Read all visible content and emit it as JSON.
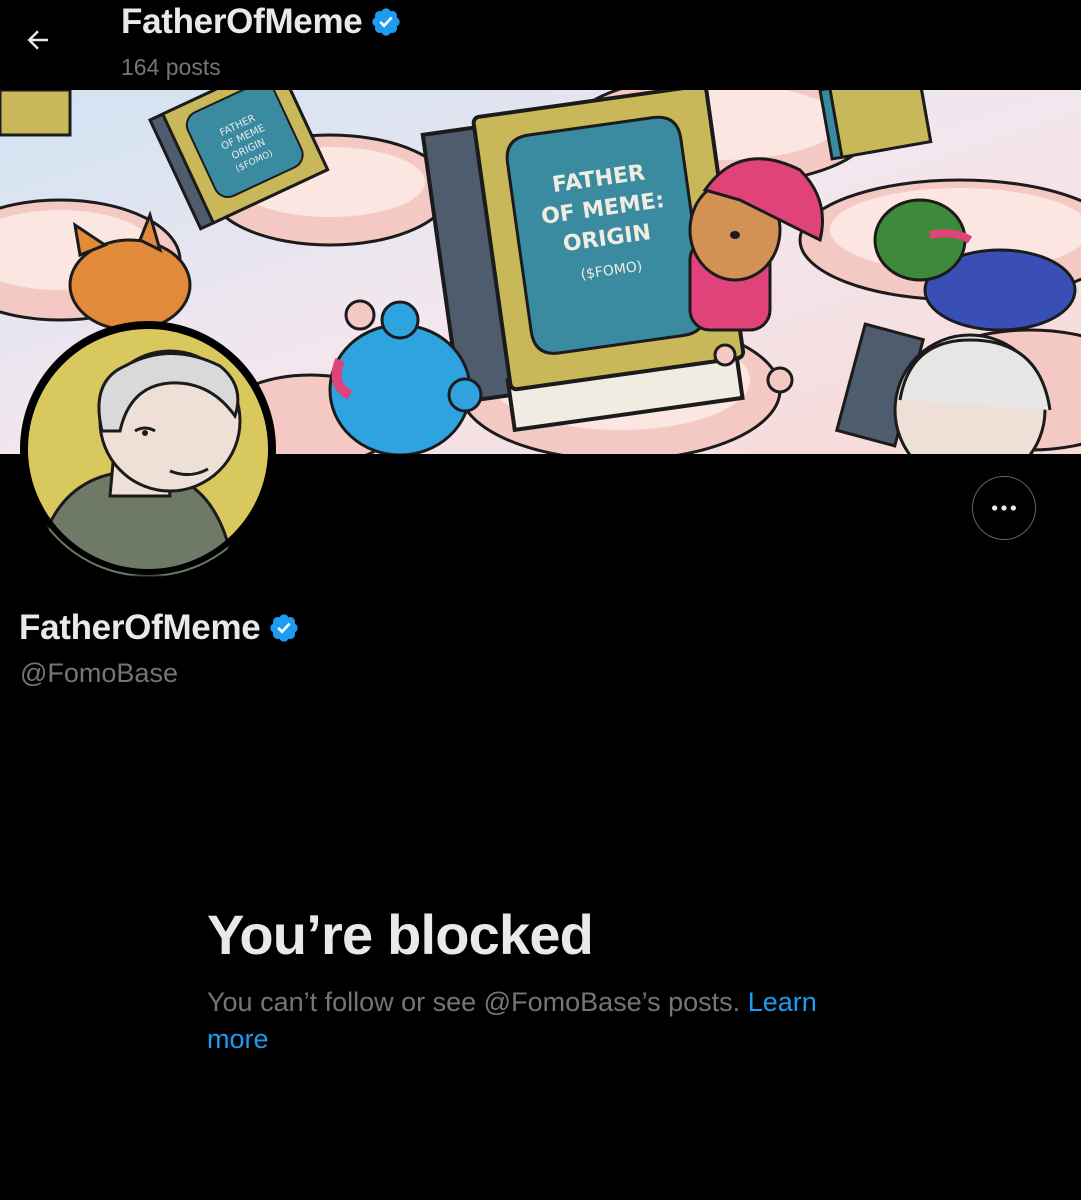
{
  "header": {
    "title": "FatherOfMeme",
    "post_count": "164 posts",
    "back_icon": "arrow-left-icon"
  },
  "banner": {
    "book_title_lines": [
      "FATHER",
      "OF MEME:",
      "ORIGIN",
      "($FOMO)"
    ],
    "small_book_lines": [
      "FATHER",
      "OF MEME",
      "ORIGIN",
      "($FOMO)"
    ]
  },
  "profile": {
    "display_name": "FatherOfMeme",
    "handle": "@FomoBase",
    "verified_icon": "verified-badge-icon",
    "more_icon": "more-options-icon"
  },
  "blocked": {
    "title": "You’re blocked",
    "message": "You can’t follow or see @FomoBase’s posts.",
    "link_text": "Learn more"
  },
  "colors": {
    "background": "#000000",
    "primary_text": "#e7e9ea",
    "secondary_text": "#71767b",
    "accent": "#1d9bf0"
  }
}
